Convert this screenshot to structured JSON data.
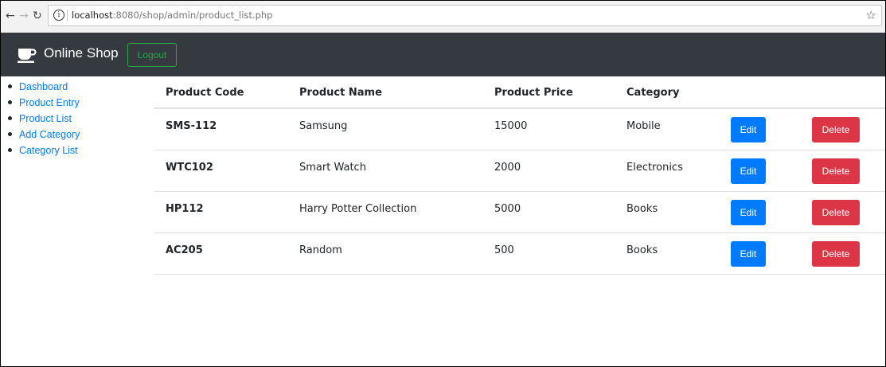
{
  "browser": {
    "url_host": "localhost",
    "url_path": ":8080/shop/admin/product_list.php",
    "back_icon": "arrow-left",
    "forward_icon": "arrow-right",
    "reload_icon": "reload",
    "info_icon": "info",
    "bookmark_icon": "star"
  },
  "navbar": {
    "brand": "Online Shop",
    "brand_icon": "coffee-cup",
    "logout_label": "Logout",
    "bg_color": "#343a40",
    "logout_color": "#28a745"
  },
  "sidebar": {
    "items": [
      {
        "label": "Dashboard"
      },
      {
        "label": "Product Entry"
      },
      {
        "label": "Product List"
      },
      {
        "label": "Add Category"
      },
      {
        "label": "Category List"
      }
    ],
    "link_color": "#007bff"
  },
  "table": {
    "headers": {
      "code": "Product Code",
      "name": "Product Name",
      "price": "Product Price",
      "category": "Category"
    },
    "rows": [
      {
        "code": "SMS-112",
        "name": "Samsung",
        "price": "15000",
        "category": "Mobile",
        "edit": "Edit",
        "delete": "Delete"
      },
      {
        "code": "WTC102",
        "name": "Smart Watch",
        "price": "2000",
        "category": "Electronics",
        "edit": "Edit",
        "delete": "Delete"
      },
      {
        "code": "HP112",
        "name": "Harry Potter Collection",
        "price": "5000",
        "category": "Books",
        "edit": "Edit",
        "delete": "Delete"
      },
      {
        "code": "AC205",
        "name": "Random",
        "price": "500",
        "category": "Books",
        "edit": "Edit",
        "delete": "Delete"
      }
    ],
    "edit_color": "#007bff",
    "delete_color": "#dc3545"
  }
}
